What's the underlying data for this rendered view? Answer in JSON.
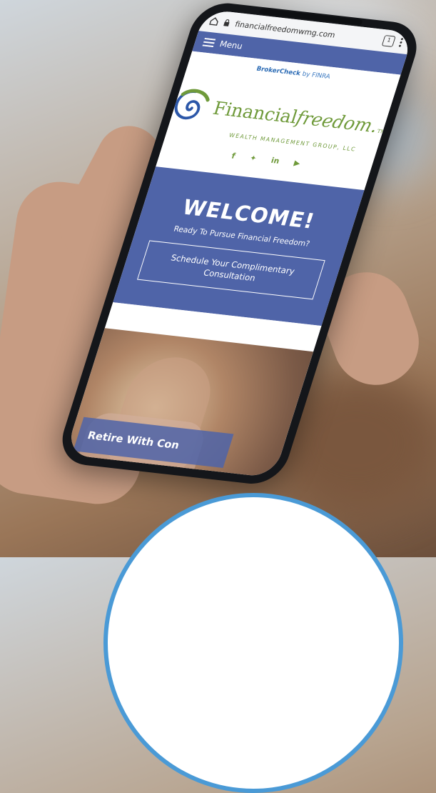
{
  "browser": {
    "url": "financialfreedomwmg.com",
    "tabs_count": "1"
  },
  "menu": {
    "label": "Menu"
  },
  "broker_check": {
    "brand": "BrokerCheck",
    "by": "by FINRA"
  },
  "logo": {
    "brand_regular": "Financial",
    "brand_italic": "freedom.",
    "tm": "TM",
    "subtitle": "WEALTH MANAGEMENT GROUP, LLC"
  },
  "social": {
    "facebook": "f",
    "twitter": "✦",
    "linkedin": "in",
    "youtube": "▶"
  },
  "hero": {
    "title": "WELCOME!",
    "subtitle": "Ready To Pursue Financial Freedom?",
    "cta": "Schedule Your Complimentary Consultation"
  },
  "banner": {
    "text": "Retire With Con"
  },
  "colors": {
    "primary": "#4f64a8",
    "brand_green": "#6f9a3a",
    "ring_blue": "#4a9ad6"
  }
}
